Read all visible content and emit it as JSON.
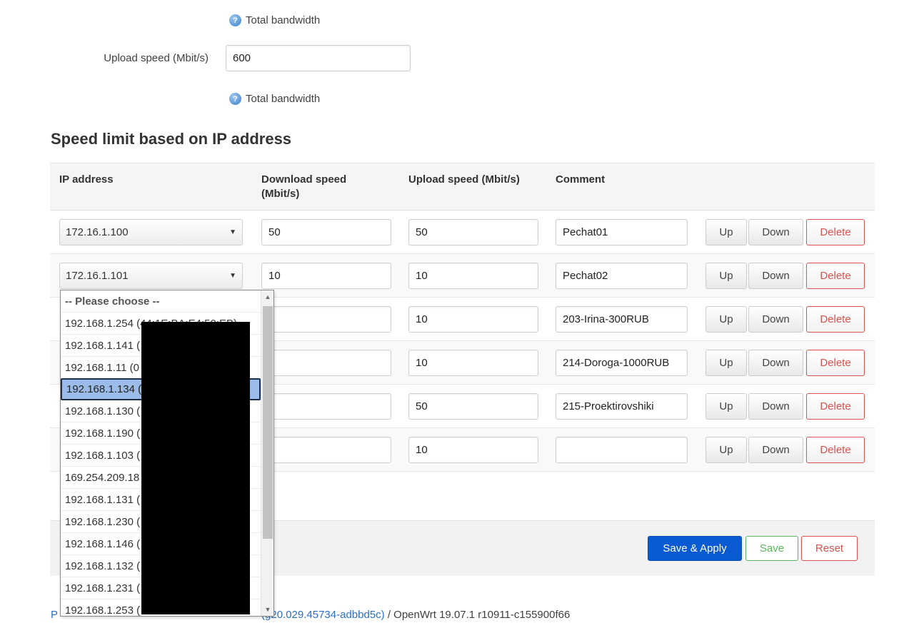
{
  "form": {
    "help_text_1": "Total bandwidth",
    "upload_label": "Upload speed (Mbit/s)",
    "upload_value": "600",
    "help_text_2": "Total bandwidth"
  },
  "section": {
    "title": "Speed limit based on IP address"
  },
  "table": {
    "headers": {
      "ip": "IP address",
      "download_line1": "Download speed",
      "download_line2": "(Mbit/s)",
      "upload": "Upload speed (Mbit/s)",
      "comment": "Comment"
    },
    "rows": [
      {
        "ip": "172.16.1.100",
        "download": "50",
        "upload": "50",
        "comment": "Pechat01"
      },
      {
        "ip": "172.16.1.101",
        "download": "10",
        "upload": "10",
        "comment": "Pechat02"
      },
      {
        "ip": "",
        "download": "0",
        "upload": "10",
        "comment": "203-Irina-300RUB"
      },
      {
        "ip": "",
        "download": "0",
        "upload": "10",
        "comment": "214-Doroga-1000RUB"
      },
      {
        "ip": "",
        "download": "0",
        "upload": "50",
        "comment": "215-Proektirovshiki"
      },
      {
        "ip": "",
        "download": "0",
        "upload": "10",
        "comment": ""
      }
    ],
    "buttons": {
      "up": "Up",
      "down": "Down",
      "delete": "Delete"
    }
  },
  "dropdown": {
    "options": [
      "-- Please choose --",
      "192.168.1.254 (44:1E:BA:E4:50:EB)",
      "192.168.1.141 (",
      "192.168.1.11 (0",
      "192.168.1.134 (",
      "192.168.1.130 (",
      "192.168.1.190 (",
      "192.168.1.103 (",
      "169.254.209.18                          3)",
      "192.168.1.131 (",
      "192.168.1.230 (",
      "192.168.1.146 (",
      "192.168.1.132 (",
      "192.168.1.231 (",
      "192.168.1.253 ("
    ],
    "selected_index": 4
  },
  "actions": {
    "save_apply": "Save & Apply",
    "save": "Save",
    "reset": "Reset"
  },
  "footer": {
    "link_tail": "20.029.45734-adbbd5c)",
    "version": " / OpenWrt 19.07.1 r10911-c155900f66"
  },
  "colors": {
    "primary": "#0a5bd3",
    "success": "#5cb85c",
    "danger": "#d9534f",
    "selected_option": "#9bbce8"
  }
}
